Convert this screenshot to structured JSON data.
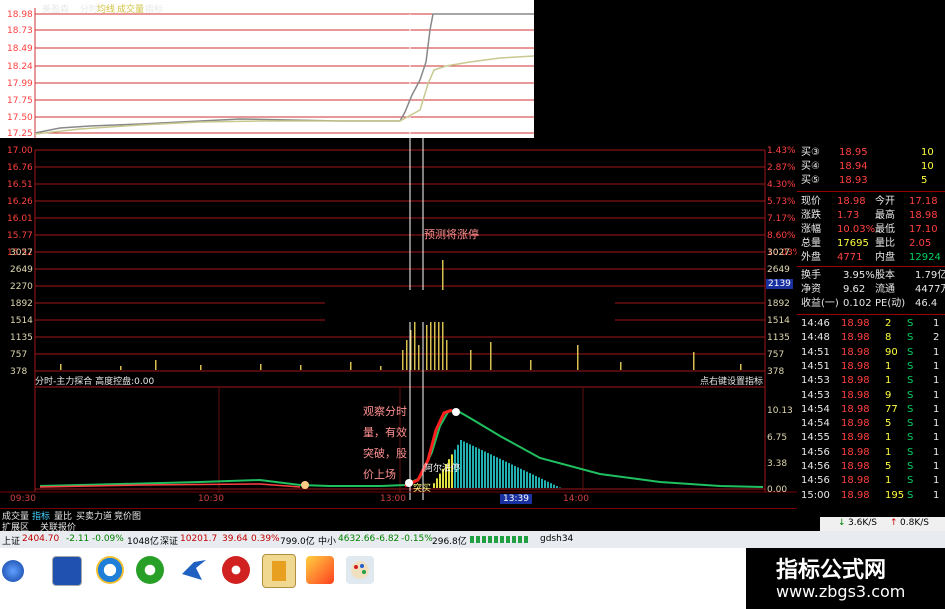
{
  "top_header": {
    "stock_name": "美盈森",
    "tabs": [
      "分时",
      "均线",
      "成交量",
      "指标"
    ]
  },
  "price_chart": {
    "price_ticks_top": [
      "18.98",
      "18.73",
      "18.49",
      "18.24",
      "17.99",
      "17.75",
      "17.50",
      "17.25"
    ],
    "price_ticks": [
      "17.00",
      "16.76",
      "16.51",
      "16.26",
      "16.01",
      "15.77",
      "15.52"
    ],
    "pct_ticks": [
      "1.43%",
      "2.87%",
      "4.30%",
      "5.73%",
      "7.17%",
      "8.60%",
      "10.03%"
    ],
    "volume_ticks": [
      "3027",
      "2649",
      "2270",
      "1892",
      "1514",
      "1135",
      "757",
      "378"
    ],
    "volume_marker": "2139",
    "annotation_top": "预测将涨停"
  },
  "indicator": {
    "title": "分时-主力探合 高度控盘:0.00",
    "right_title": "点右键设置指标",
    "ticks": [
      "10.13",
      "6.75",
      "3.38",
      "0.00"
    ],
    "note_lines": [
      "观察分时",
      "量，有效",
      "突破，股",
      "价上场"
    ],
    "mid_label": "阿尔法停",
    "low_label": "突买"
  },
  "time_axis": {
    "labels": [
      "09:30",
      "10:30",
      "13:00",
      "14:00"
    ],
    "cursor": "13:39"
  },
  "bottom_tabs": [
    "成交量",
    "指标",
    "量比",
    "买卖力道",
    "竞价图"
  ],
  "bottom_tabs2": [
    "扩展区",
    "关联报价"
  ],
  "index_bar": {
    "sh_label": "上证",
    "sh_value": "2404.70",
    "sh_change": "-2.11",
    "sh_pct": "-0.09%",
    "sh_amount": "1048亿",
    "sz_label": "深证",
    "sz_value": "10201.7",
    "sz_change": "39.64",
    "sz_pct": "0.39%",
    "sz_amount": "799.0亿",
    "zx_label": "中小",
    "zx_value": "4632.66",
    "zx_change": "-6.82",
    "zx_pct": "-0.15%",
    "zx_amount": "296.8亿",
    "code": "gdsh34"
  },
  "quote": {
    "bids": [
      {
        "label": "买③",
        "price": "18.95",
        "vol": "10"
      },
      {
        "label": "买④",
        "price": "18.94",
        "vol": "10"
      },
      {
        "label": "买⑤",
        "price": "18.93",
        "vol": "5"
      }
    ],
    "stats": [
      {
        "k1": "现价",
        "v1": "18.98",
        "k2": "今开",
        "v2": "17.18"
      },
      {
        "k1": "涨跌",
        "v1": "1.73",
        "k2": "最高",
        "v2": "18.98"
      },
      {
        "k1": "涨幅",
        "v1": "10.03%",
        "k2": "最低",
        "v2": "17.10"
      },
      {
        "k1": "总量",
        "v1": "17695",
        "k2": "量比",
        "v2": "2.05"
      },
      {
        "k1": "外盘",
        "v1": "4771",
        "k2": "内盘",
        "v2": "12924"
      }
    ],
    "stats2": [
      {
        "k1": "换手",
        "v1": "3.95%",
        "k2": "股本",
        "v2": "1.79亿"
      },
      {
        "k1": "净资",
        "v1": "9.62",
        "k2": "流通",
        "v2": "4477万"
      },
      {
        "k1": "收益(一)",
        "v1": "0.102",
        "k2": "PE(动)",
        "v2": "46.4"
      }
    ],
    "ticks": [
      {
        "t": "14:46",
        "p": "18.98",
        "v": "2",
        "d": "S",
        "n": "1"
      },
      {
        "t": "14:48",
        "p": "18.98",
        "v": "8",
        "d": "S",
        "n": "2"
      },
      {
        "t": "14:51",
        "p": "18.98",
        "v": "90",
        "d": "S",
        "n": "1"
      },
      {
        "t": "14:51",
        "p": "18.98",
        "v": "1",
        "d": "S",
        "n": "1"
      },
      {
        "t": "14:53",
        "p": "18.98",
        "v": "1",
        "d": "S",
        "n": "1"
      },
      {
        "t": "14:53",
        "p": "18.98",
        "v": "9",
        "d": "S",
        "n": "1"
      },
      {
        "t": "14:54",
        "p": "18.98",
        "v": "77",
        "d": "S",
        "n": "1"
      },
      {
        "t": "14:54",
        "p": "18.98",
        "v": "5",
        "d": "S",
        "n": "1"
      },
      {
        "t": "14:55",
        "p": "18.98",
        "v": "1",
        "d": "S",
        "n": "1"
      },
      {
        "t": "14:56",
        "p": "18.98",
        "v": "1",
        "d": "S",
        "n": "1"
      },
      {
        "t": "14:56",
        "p": "18.98",
        "v": "5",
        "d": "S",
        "n": "1"
      },
      {
        "t": "14:56",
        "p": "18.98",
        "v": "1",
        "d": "S",
        "n": "1"
      },
      {
        "t": "15:00",
        "p": "18.98",
        "v": "195",
        "d": "S",
        "n": "1"
      }
    ],
    "net_speed": {
      "down": "3.6K/S",
      "up": "0.8K/S"
    }
  },
  "watermark": {
    "title": "指标公式网",
    "url": "www.zbgs3.com"
  }
}
